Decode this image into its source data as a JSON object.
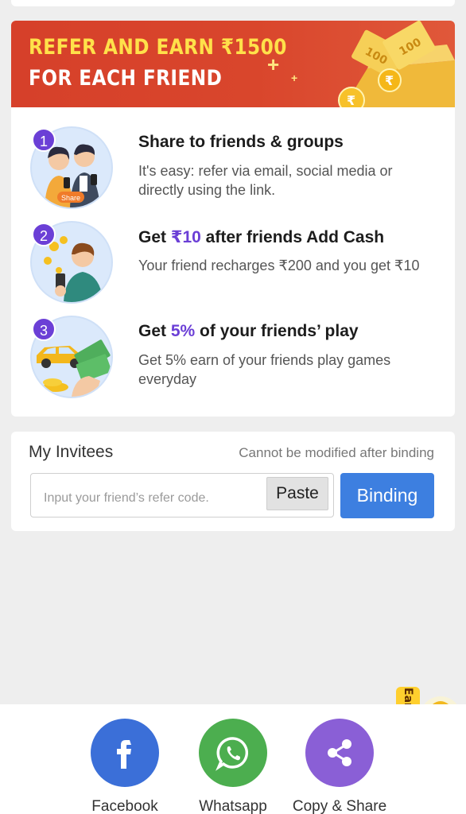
{
  "banner": {
    "line1": "REFER AND EARN ₹1500",
    "line2": "FOR EACH FRIEND",
    "art_text_1": "100",
    "art_text_2": "100",
    "art_symbol": "₹"
  },
  "steps": [
    {
      "number": "1",
      "title_pre": "Share to friends & groups",
      "title_hl": "",
      "title_post": "",
      "desc": "It's easy: refer via email, social media or directly using the link.",
      "badge": "Share"
    },
    {
      "number": "2",
      "title_pre": "Get ",
      "title_hl": "₹10",
      "title_post": " after friends Add Cash",
      "desc": "Your friend recharges ₹200 and you get ₹10"
    },
    {
      "number": "3",
      "title_pre": "Get ",
      "title_hl": "5%",
      "title_post": " of your friends’ play",
      "desc": "Get 5% earn of your friends play games everyday"
    }
  ],
  "invitees": {
    "title": "My Invitees",
    "note": "Cannot be modified after binding",
    "input_placeholder": "Input your friend’s refer code.",
    "paste_label": "Paste",
    "binding_label": "Binding"
  },
  "share": [
    {
      "label": "Facebook",
      "icon": "facebook-icon",
      "color": "#3b6fd8"
    },
    {
      "label": "Whatsapp",
      "icon": "whatsapp-icon",
      "color": "#4cae4f"
    },
    {
      "label": "Copy & Share",
      "icon": "share-icon",
      "color": "#8a5fd6"
    }
  ],
  "earn_cash": {
    "label": "Earn Cash"
  },
  "colors": {
    "banner_red": "#d6402a",
    "banner_yellow": "#ffe14a",
    "accent_purple": "#6b3fd6",
    "binding_blue": "#3d7fe0"
  }
}
